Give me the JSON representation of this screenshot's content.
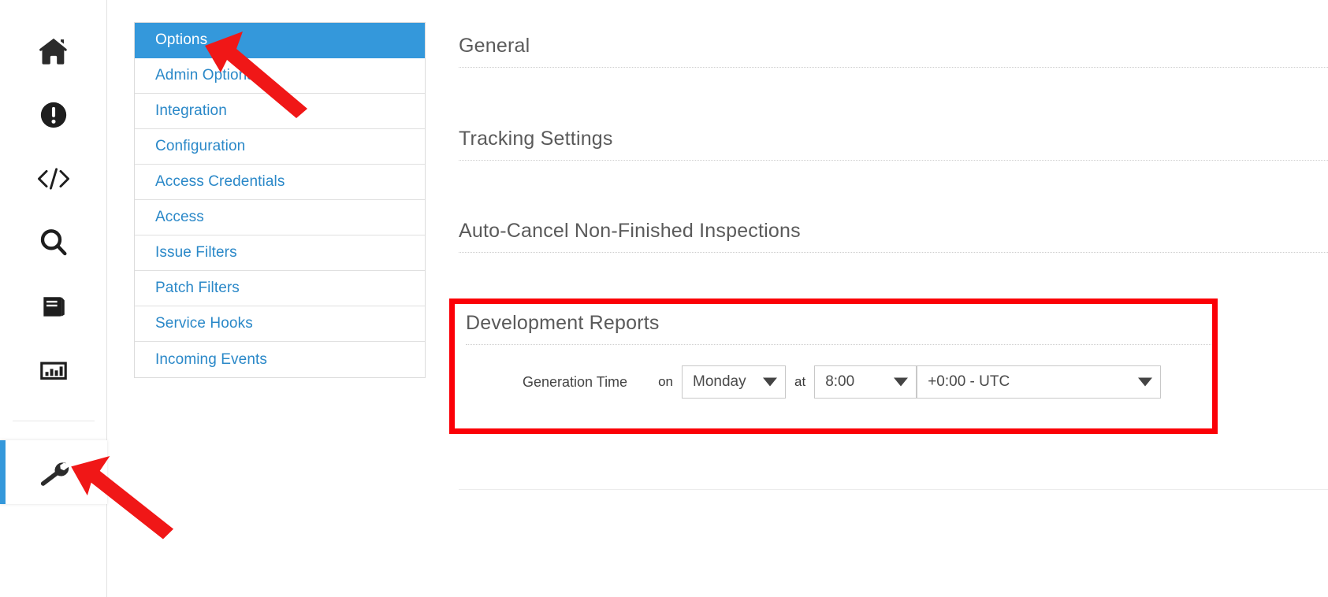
{
  "icon_rail": {
    "items": [
      {
        "name": "home-icon",
        "label": "Home"
      },
      {
        "name": "alert-circle-icon",
        "label": "Issues"
      },
      {
        "name": "code-icon",
        "label": "Code"
      },
      {
        "name": "search-icon",
        "label": "Search"
      },
      {
        "name": "book-icon",
        "label": "Documentation"
      },
      {
        "name": "chart-bar-icon",
        "label": "Reports"
      }
    ],
    "active_item": {
      "name": "wrench-icon",
      "label": "Settings"
    },
    "active_indicator_color": "#3498db"
  },
  "nav_list": {
    "items": [
      {
        "label": "Options",
        "active": true
      },
      {
        "label": "Admin Options",
        "active": false
      },
      {
        "label": "Integration",
        "active": false
      },
      {
        "label": "Configuration",
        "active": false
      },
      {
        "label": "Access Credentials",
        "active": false
      },
      {
        "label": "Access",
        "active": false
      },
      {
        "label": "Issue Filters",
        "active": false
      },
      {
        "label": "Patch Filters",
        "active": false
      },
      {
        "label": "Service Hooks",
        "active": false
      },
      {
        "label": "Incoming Events",
        "active": false
      }
    ],
    "active_background": "#3498db",
    "link_color": "#2a88c8"
  },
  "main": {
    "sections": [
      {
        "title": "General"
      },
      {
        "title": "Tracking Settings"
      },
      {
        "title": "Auto-Cancel Non-Finished Inspections"
      }
    ],
    "development_reports": {
      "title": "Development Reports",
      "highlight_color": "#fb0007",
      "generation_time": {
        "label": "Generation Time",
        "conj_on": "on",
        "conj_at": "at",
        "day": "Monday",
        "time": "8:00",
        "timezone": "+0:00 - UTC",
        "caret_icon": "chevron-down-icon"
      }
    }
  },
  "annotations": {
    "arrow_color": "#f01717",
    "pointers": [
      {
        "name": "arrow-pointing-to-options",
        "target": "Options"
      },
      {
        "name": "arrow-pointing-to-settings-wrench",
        "target": "Settings"
      }
    ]
  }
}
